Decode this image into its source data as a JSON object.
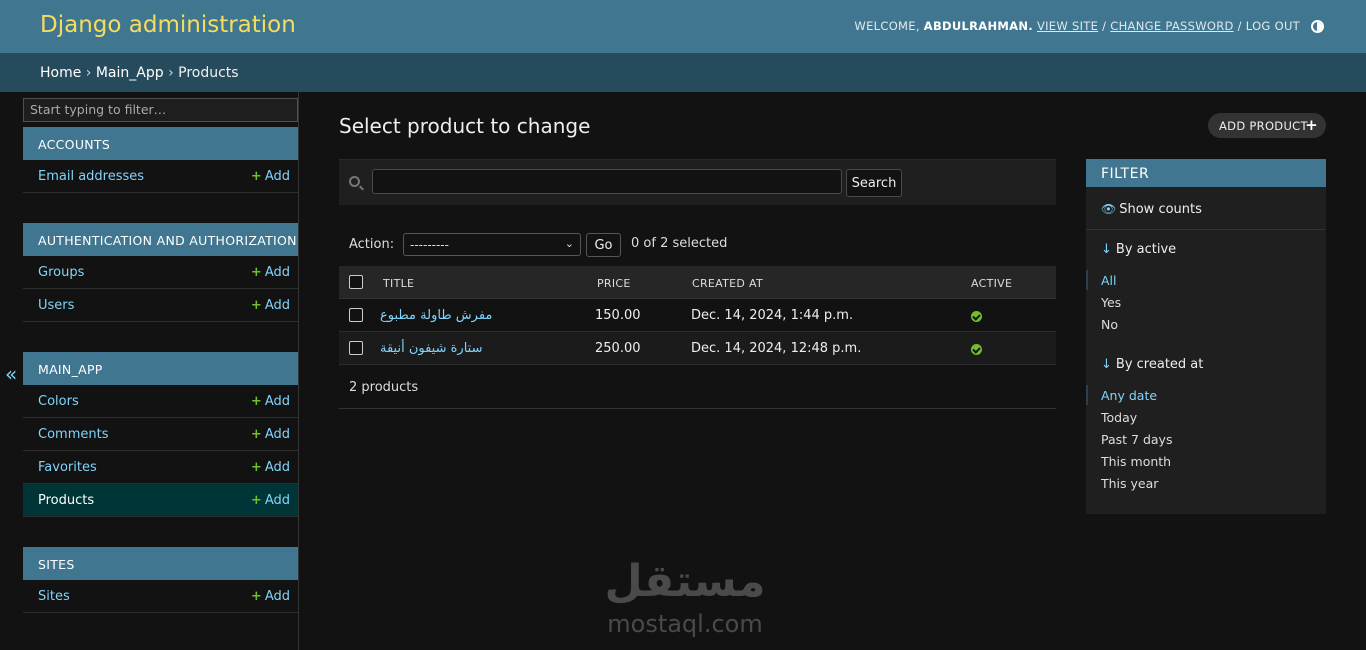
{
  "header": {
    "site_name": "Django administration",
    "welcome": "WELCOME,",
    "username": "ABDULRAHMAN.",
    "view_site": "VIEW SITE",
    "change_password": "CHANGE PASSWORD",
    "log_out": "LOG OUT",
    "separator": " / "
  },
  "breadcrumbs": {
    "home": "Home",
    "app": "Main_App",
    "current": "Products",
    "sep": " › "
  },
  "sidebar": {
    "filter_placeholder": "Start typing to filter…",
    "collapse": "«",
    "add_label": "Add",
    "apps": [
      {
        "name": "ACCOUNTS",
        "models": [
          "Email addresses"
        ]
      },
      {
        "name": "AUTHENTICATION AND AUTHORIZATION",
        "models": [
          "Groups",
          "Users"
        ]
      },
      {
        "name": "MAIN_APP",
        "models": [
          "Colors",
          "Comments",
          "Favorites",
          "Products"
        ]
      },
      {
        "name": "SITES",
        "models": [
          "Sites"
        ]
      }
    ]
  },
  "content": {
    "title": "Select product to change",
    "add_button": "ADD PRODUCT",
    "search_button": "Search",
    "action_label": "Action:",
    "action_value": "---------",
    "go_button": "Go",
    "counter": "0 of 2 selected",
    "columns": [
      "TITLE",
      "PRICE",
      "CREATED AT",
      "ACTIVE"
    ],
    "rows": [
      {
        "title": "مفرش طاولة مطبوع",
        "price": "150.00",
        "created_at": "Dec. 14, 2024, 1:44 p.m.",
        "active": true
      },
      {
        "title": "ستارة شيفون أنيقة",
        "price": "250.00",
        "created_at": "Dec. 14, 2024, 12:48 p.m.",
        "active": true
      }
    ],
    "paginator": "2 products"
  },
  "filter": {
    "header": "FILTER",
    "show_counts": "Show counts",
    "groups": [
      {
        "title": "By active",
        "options": [
          "All",
          "Yes",
          "No"
        ],
        "selected": "All"
      },
      {
        "title": "By created at",
        "options": [
          "Any date",
          "Today",
          "Past 7 days",
          "This month",
          "This year"
        ],
        "selected": "Any date"
      }
    ]
  },
  "watermark": {
    "arabic": "مستقل",
    "latin": "mostaql.com"
  },
  "colors": {
    "header_bg": "#417690",
    "site_name": "#f5dd5d",
    "link": "#81d4fa",
    "add_plus": "#70bf2b",
    "breadcrumbs_bg": "#264b5d",
    "body_bg": "#121212"
  },
  "icons": {
    "theme": "theme-toggle-icon",
    "search": "search-icon",
    "active_yes": "check-circle-icon",
    "sort_arrow": "arrow-down-icon",
    "eye": "eye-icon"
  }
}
